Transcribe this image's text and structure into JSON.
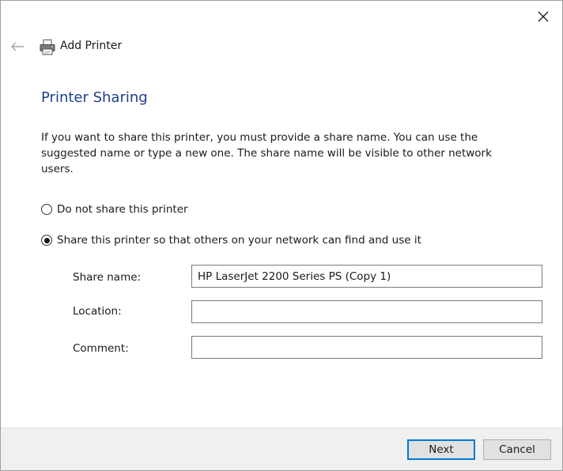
{
  "window": {
    "title": "Add Printer"
  },
  "page": {
    "heading": "Printer Sharing",
    "description": "If you want to share this printer, you must provide a share name. You can use the suggested name or type a new one. The share name will be visible to other network users."
  },
  "sharing_options": {
    "do_not_share_label": "Do not share this printer",
    "share_label": "Share this printer so that others on your network can find and use it",
    "selected": "share"
  },
  "fields": {
    "share_name_label": "Share name:",
    "share_name_value": "HP LaserJet 2200 Series PS (Copy 1)",
    "location_label": "Location:",
    "location_value": "",
    "comment_label": "Comment:",
    "comment_value": ""
  },
  "footer": {
    "next_label": "Next",
    "cancel_label": "Cancel"
  },
  "icons": {
    "back": "back-arrow-icon",
    "close": "close-icon",
    "printer": "printer-icon"
  },
  "colors": {
    "heading": "#1e3f8a",
    "primary_button_border": "#0078d7",
    "footer_background": "#f0f0f0"
  }
}
